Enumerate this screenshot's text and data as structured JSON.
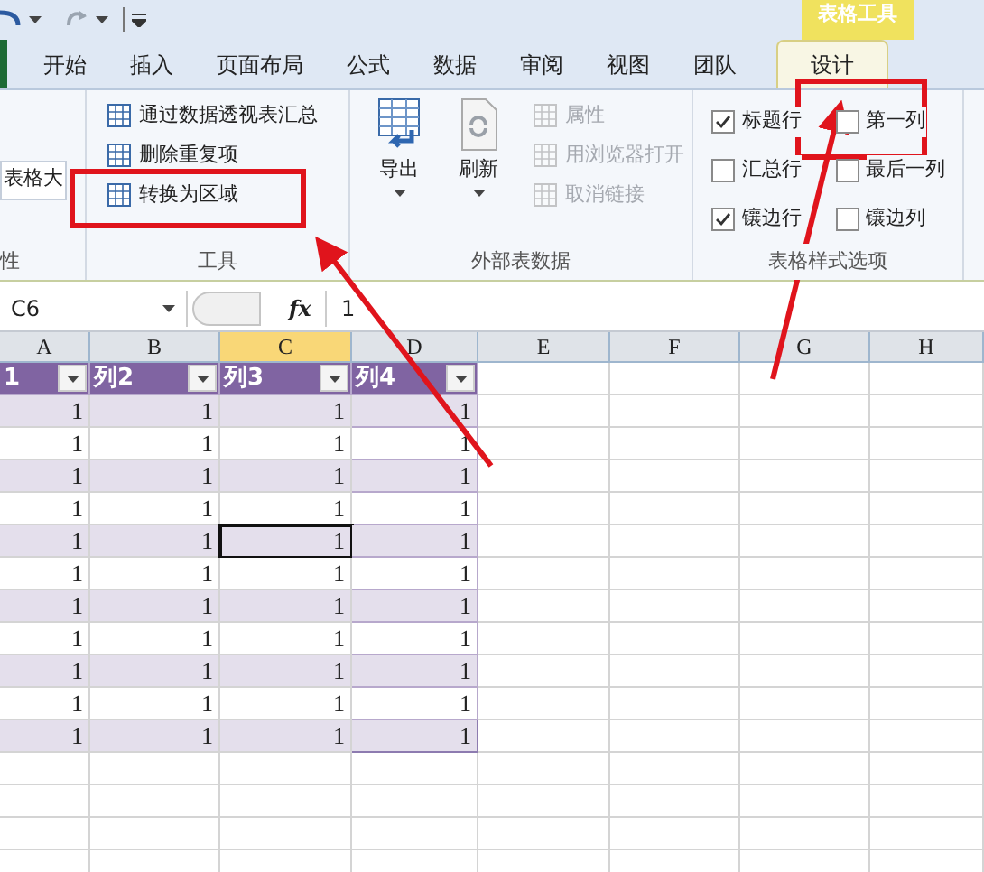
{
  "title_bar": {
    "contextual_group": "表格工具"
  },
  "tabs": [
    {
      "label": "开始",
      "selected": false
    },
    {
      "label": "插入",
      "selected": false
    },
    {
      "label": "页面布局",
      "selected": false
    },
    {
      "label": "公式",
      "selected": false
    },
    {
      "label": "数据",
      "selected": false
    },
    {
      "label": "审阅",
      "selected": false
    },
    {
      "label": "视图",
      "selected": false
    },
    {
      "label": "团队",
      "selected": false
    },
    {
      "label": "设计",
      "selected": true
    }
  ],
  "ribbon": {
    "properties_group": {
      "title": "性",
      "field": "表格大"
    },
    "tools_group": {
      "title": "工具",
      "items": [
        "通过数据透视表汇总",
        "删除重复项",
        "转换为区域"
      ]
    },
    "external_group": {
      "title": "外部表数据",
      "large_buttons": [
        "导出",
        "刷新"
      ],
      "small_buttons": [
        {
          "label": "属性",
          "disabled": true
        },
        {
          "label": "用浏览器打开",
          "disabled": true
        },
        {
          "label": "取消链接",
          "disabled": true
        }
      ]
    },
    "style_group": {
      "title": "表格样式选项",
      "options": [
        {
          "label": "标题行",
          "checked": true
        },
        {
          "label": "汇总行",
          "checked": false
        },
        {
          "label": "镶边行",
          "checked": true
        },
        {
          "label": "第一列",
          "checked": false
        },
        {
          "label": "最后一列",
          "checked": false
        },
        {
          "label": "镶边列",
          "checked": false
        }
      ]
    }
  },
  "formula_bar": {
    "name_box": "C6",
    "function_label": "fx",
    "formula": "1"
  },
  "columns": [
    {
      "label": "A",
      "selected": false
    },
    {
      "label": "B",
      "selected": false
    },
    {
      "label": "C",
      "selected": true
    },
    {
      "label": "D",
      "selected": false
    },
    {
      "label": "E",
      "selected": false
    },
    {
      "label": "F",
      "selected": false
    },
    {
      "label": "G",
      "selected": false
    },
    {
      "label": "H",
      "selected": false
    }
  ],
  "table": {
    "headers": [
      "1",
      "列2",
      "列3",
      "列4"
    ],
    "rows": [
      [
        {
          "text": "1",
          "active": false
        },
        {
          "text": "1",
          "active": false
        },
        {
          "text": "1",
          "active": false
        },
        {
          "text": "1",
          "active": false
        }
      ],
      [
        {
          "text": "1",
          "active": false
        },
        {
          "text": "1",
          "active": false
        },
        {
          "text": "1",
          "active": false
        },
        {
          "text": "1",
          "active": false
        }
      ],
      [
        {
          "text": "1",
          "active": false
        },
        {
          "text": "1",
          "active": false
        },
        {
          "text": "1",
          "active": false
        },
        {
          "text": "1",
          "active": false
        }
      ],
      [
        {
          "text": "1",
          "active": false
        },
        {
          "text": "1",
          "active": false
        },
        {
          "text": "1",
          "active": false
        },
        {
          "text": "1",
          "active": false
        }
      ],
      [
        {
          "text": "1",
          "active": false
        },
        {
          "text": "1",
          "active": false
        },
        {
          "text": "1",
          "active": true
        },
        {
          "text": "1",
          "active": false
        }
      ],
      [
        {
          "text": "1",
          "active": false
        },
        {
          "text": "1",
          "active": false
        },
        {
          "text": "1",
          "active": false
        },
        {
          "text": "1",
          "active": false
        }
      ],
      [
        {
          "text": "1",
          "active": false
        },
        {
          "text": "1",
          "active": false
        },
        {
          "text": "1",
          "active": false
        },
        {
          "text": "1",
          "active": false
        }
      ],
      [
        {
          "text": "1",
          "active": false
        },
        {
          "text": "1",
          "active": false
        },
        {
          "text": "1",
          "active": false
        },
        {
          "text": "1",
          "active": false
        }
      ],
      [
        {
          "text": "1",
          "active": false
        },
        {
          "text": "1",
          "active": false
        },
        {
          "text": "1",
          "active": false
        },
        {
          "text": "1",
          "active": false
        }
      ],
      [
        {
          "text": "1",
          "active": false
        },
        {
          "text": "1",
          "active": false
        },
        {
          "text": "1",
          "active": false
        },
        {
          "text": "1",
          "active": false
        }
      ],
      [
        {
          "text": "1",
          "active": false
        },
        {
          "text": "1",
          "active": false
        },
        {
          "text": "1",
          "active": false
        },
        {
          "text": "1",
          "active": false
        }
      ]
    ]
  }
}
